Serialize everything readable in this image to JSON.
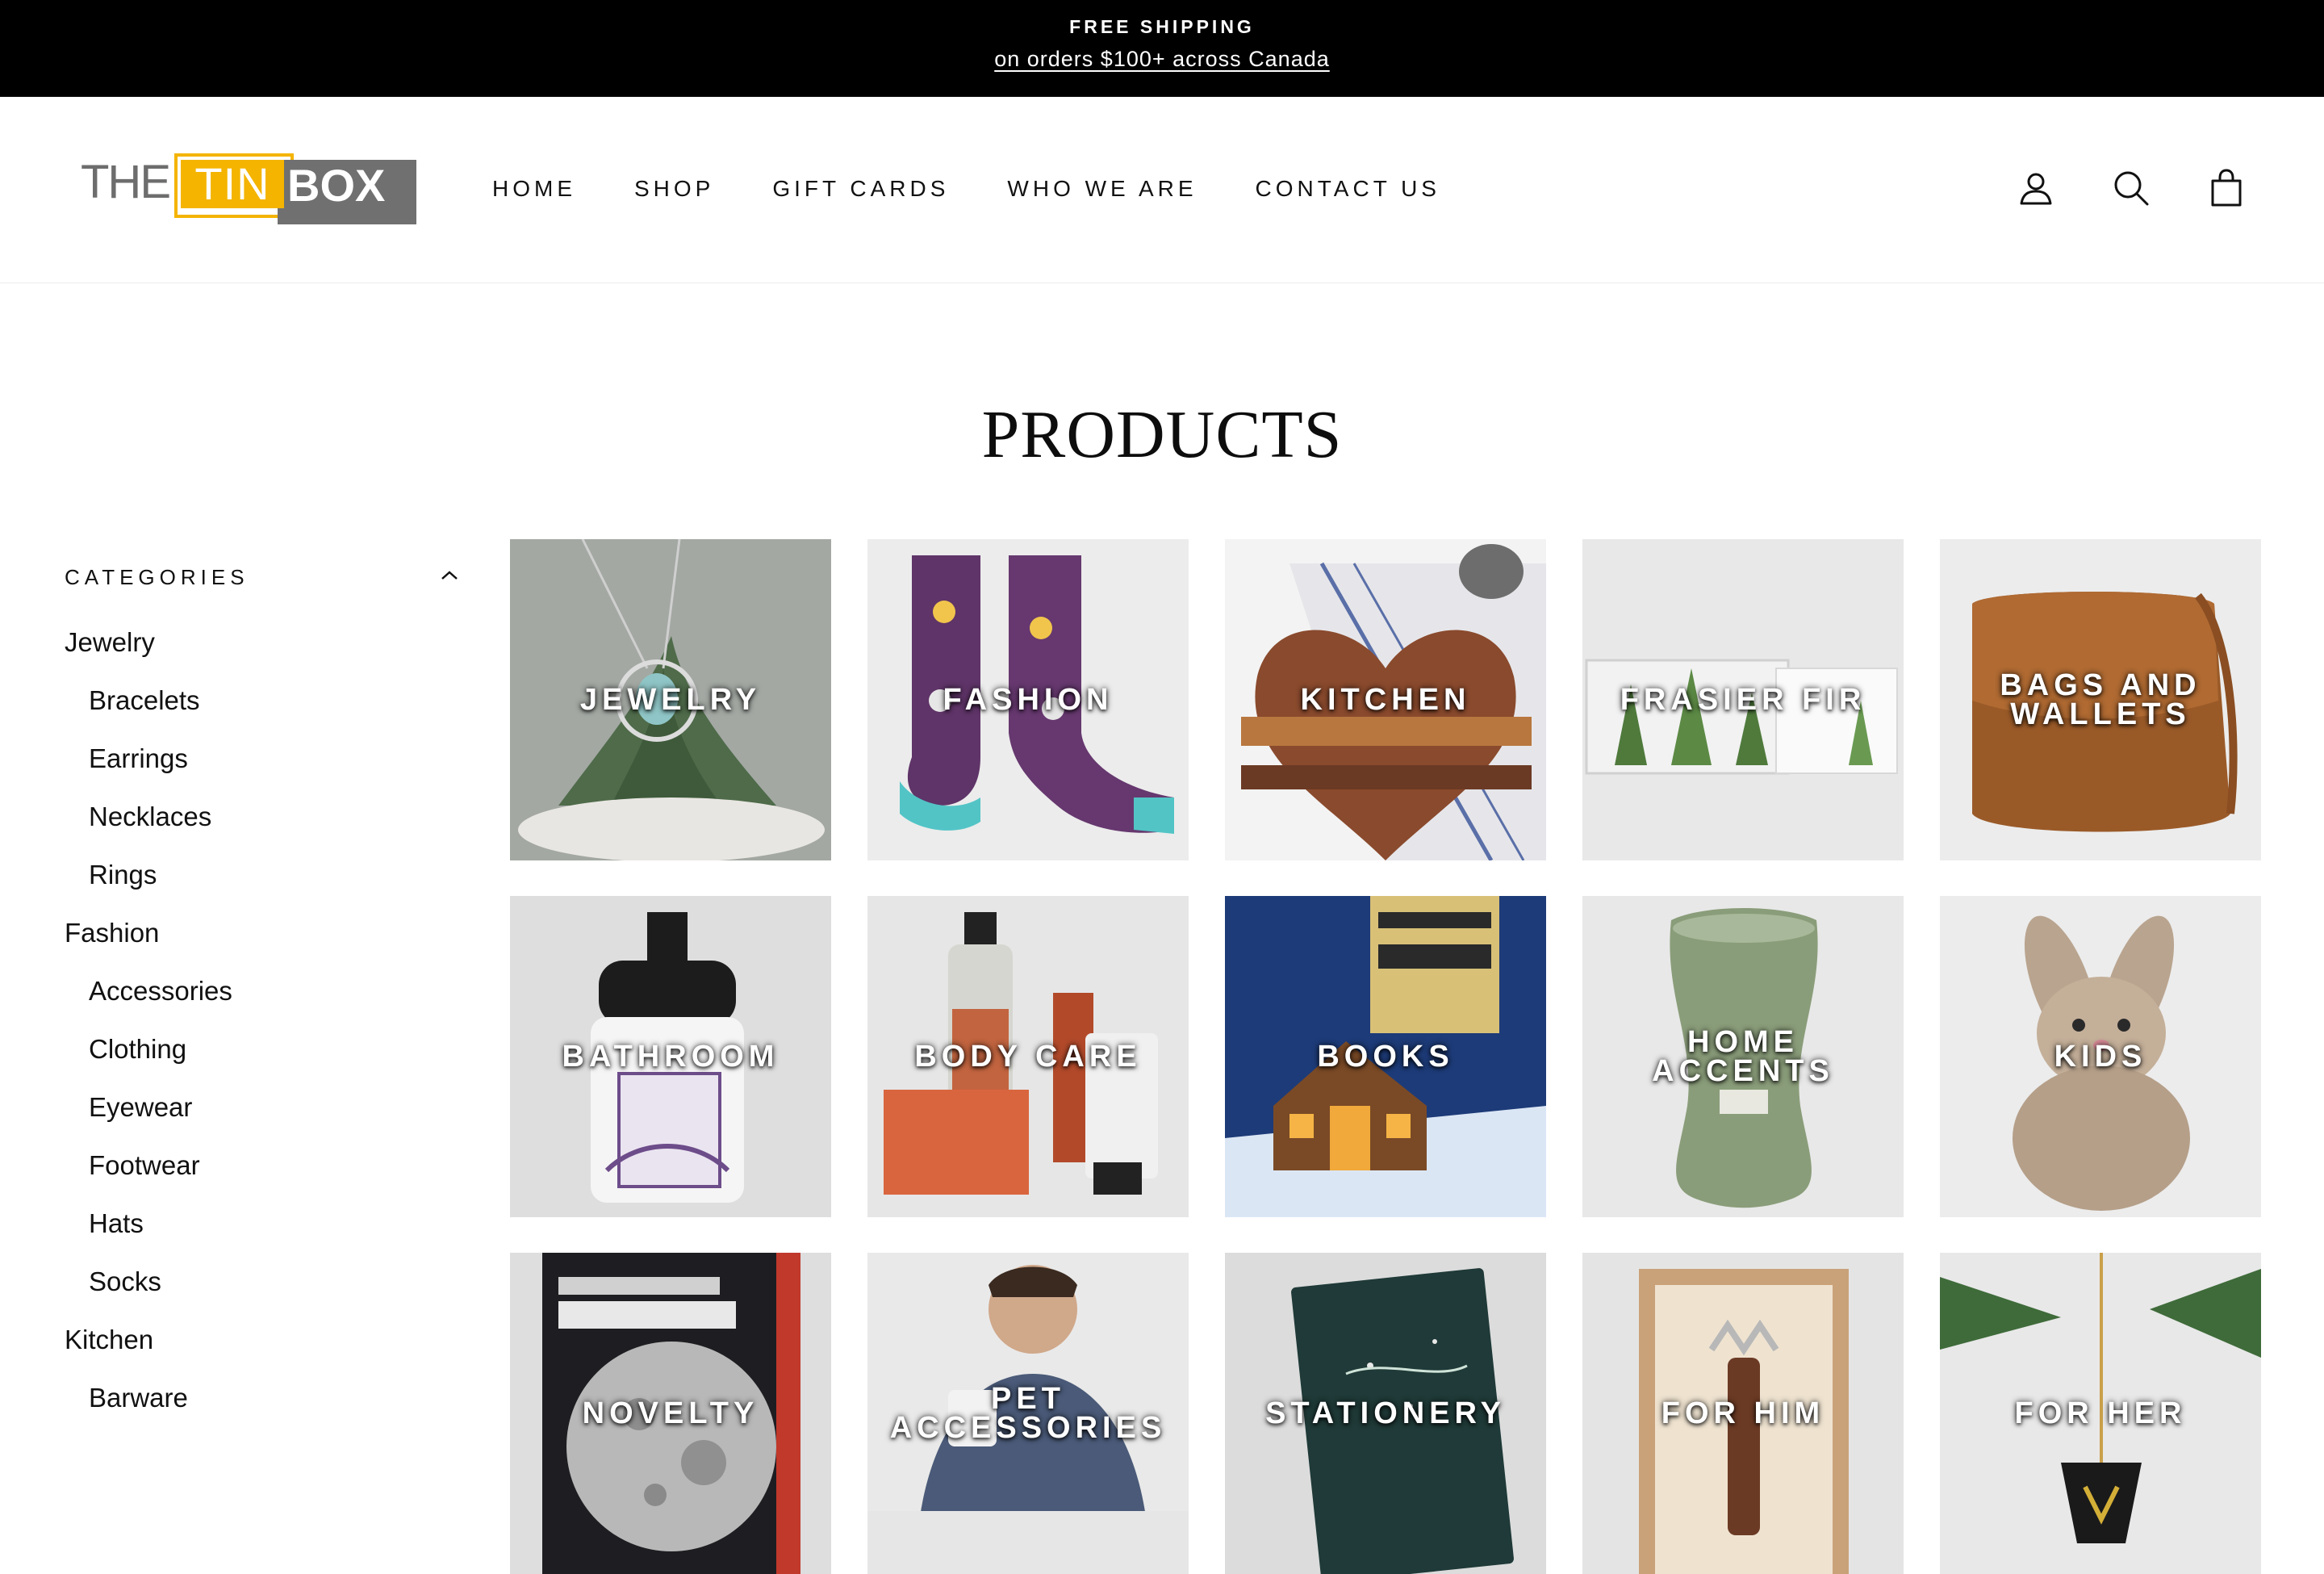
{
  "announcement": {
    "line1": "FREE SHIPPING",
    "line2": "on orders $100+ across Canada"
  },
  "logo": {
    "the": "THE",
    "tin": "TIN",
    "box": "BOX",
    "colors": {
      "tin": "#f4b400",
      "box": "#707070",
      "the": "#6d6d6d"
    }
  },
  "nav": {
    "items": [
      "HOME",
      "SHOP",
      "GIFT CARDS",
      "WHO WE ARE",
      "CONTACT US"
    ]
  },
  "header_icons": [
    "account-icon",
    "search-icon",
    "cart-icon"
  ],
  "page_title": "PRODUCTS",
  "sidebar": {
    "heading": "CATEGORIES",
    "items": [
      {
        "label": "Jewelry",
        "level": 0
      },
      {
        "label": "Bracelets",
        "level": 1
      },
      {
        "label": "Earrings",
        "level": 1
      },
      {
        "label": "Necklaces",
        "level": 1
      },
      {
        "label": "Rings",
        "level": 1
      },
      {
        "label": "Fashion",
        "level": 0
      },
      {
        "label": "Accessories",
        "level": 1
      },
      {
        "label": "Clothing",
        "level": 1
      },
      {
        "label": "Eyewear",
        "level": 1
      },
      {
        "label": "Footwear",
        "level": 1
      },
      {
        "label": "Hats",
        "level": 1
      },
      {
        "label": "Socks",
        "level": 1
      },
      {
        "label": "Kitchen",
        "level": 0
      },
      {
        "label": "Barware",
        "level": 1
      }
    ]
  },
  "products": [
    {
      "label": "JEWELRY",
      "bg": "#8e9a8c"
    },
    {
      "label": "FASHION",
      "bg": "#e9e9e9"
    },
    {
      "label": "KITCHEN",
      "bg": "#efefef"
    },
    {
      "label": "FRASIER FIR",
      "bg": "#e6e6e6"
    },
    {
      "label": "BAGS AND\nWALLETS",
      "bg": "#e8e8e8"
    },
    {
      "label": "BATHROOM",
      "bg": "#e0e0e0"
    },
    {
      "label": "BODY CARE",
      "bg": "#e4e4e4"
    },
    {
      "label": "BOOKS",
      "bg": "#1f3b6e"
    },
    {
      "label": "HOME\nACCENTS",
      "bg": "#e4e4e4"
    },
    {
      "label": "KIDS",
      "bg": "#e6e6e6"
    },
    {
      "label": "NOVELTY",
      "bg": "#2a2a2a"
    },
    {
      "label": "PET\nACCESSORIES",
      "bg": "#8d8f94"
    },
    {
      "label": "STATIONERY",
      "bg": "#d9d9d9"
    },
    {
      "label": "FOR HIM",
      "bg": "#e2e2e2"
    },
    {
      "label": "FOR HER",
      "bg": "#e4e4e4"
    }
  ]
}
